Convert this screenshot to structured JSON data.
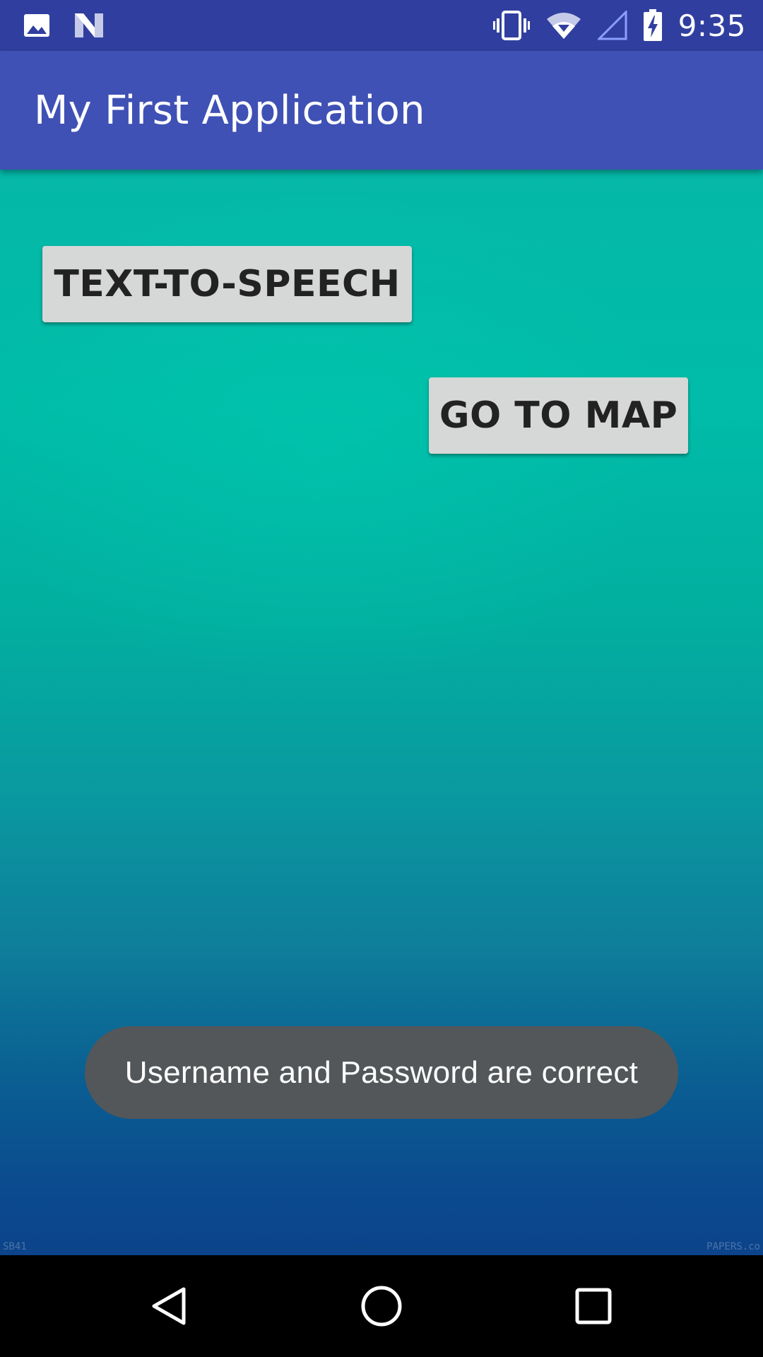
{
  "status_bar": {
    "time": "9:35",
    "icons_left": [
      "image-notification-icon",
      "n-notification-icon"
    ],
    "icons_right": [
      "vibrate-icon",
      "wifi-icon",
      "cell-signal-icon",
      "battery-charging-icon"
    ]
  },
  "app_bar": {
    "title": "My First Application"
  },
  "main": {
    "buttons": [
      {
        "label": "TEXT-TO-SPEECH"
      },
      {
        "label": "GO TO MAP"
      }
    ],
    "toast": "Username and Password are correct",
    "watermark_left": "SB41",
    "watermark_right": "PAPERS.co"
  },
  "nav_bar": {
    "icons": [
      "back-icon",
      "home-icon",
      "recents-icon"
    ]
  },
  "colors": {
    "status_bar": "#303F9F",
    "app_bar": "#3F51B5",
    "button": "#D6D7D7",
    "toast": "#535759"
  }
}
